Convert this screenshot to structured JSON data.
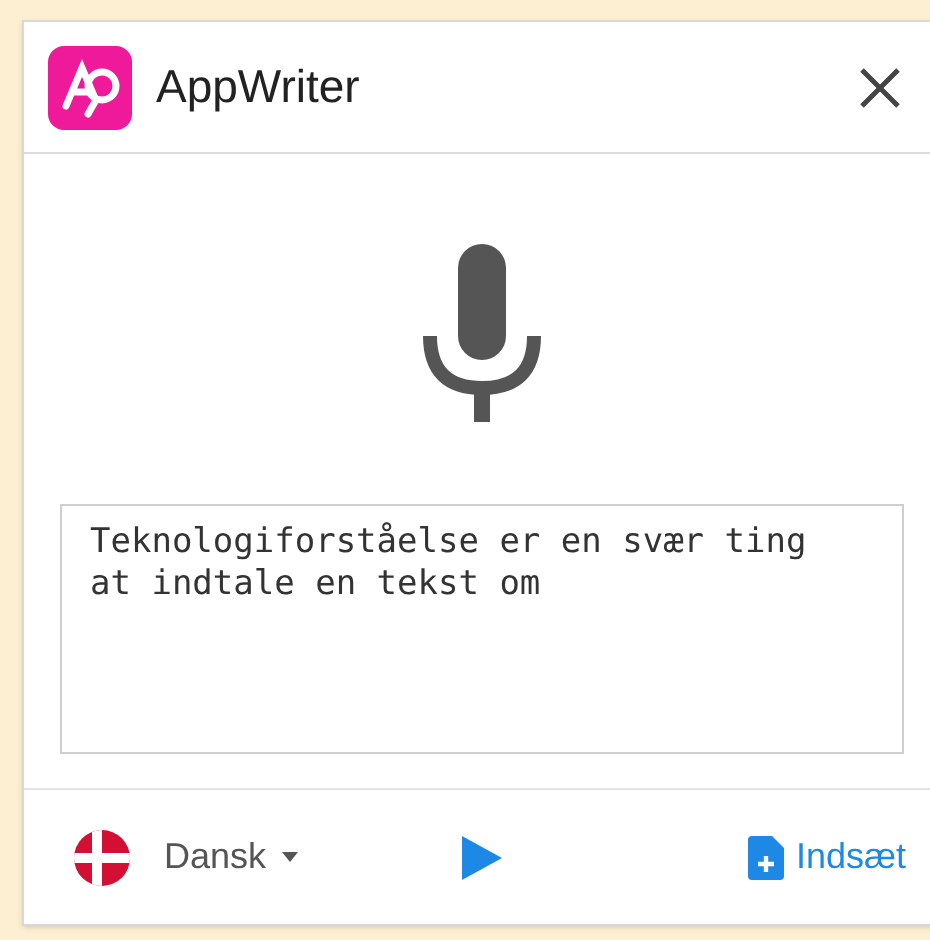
{
  "window": {
    "title": "AppWriter"
  },
  "dictation": {
    "lines": [
      "Teknologiforståelse er en svær ting",
      "at indtale en tekst om"
    ]
  },
  "footer": {
    "language": "Dansk",
    "insert_label": "Indsæt"
  }
}
